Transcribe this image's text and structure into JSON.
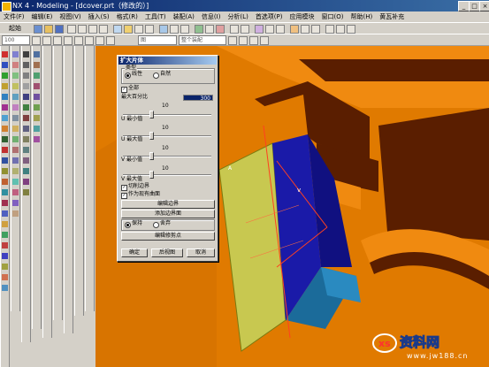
{
  "window": {
    "title": "NX 4 - Modeling - [dcover.prt（修改的）]",
    "minimize_label": "_",
    "maximize_label": "□",
    "close_label": "×"
  },
  "menubar": {
    "items": [
      "文件(F)",
      "编辑(E)",
      "视图(V)",
      "插入(S)",
      "格式(R)",
      "工具(T)",
      "装配(A)",
      "信息(I)",
      "分析(L)",
      "首选项(P)",
      "应用模块",
      "窗口(O)",
      "帮助(H)",
      "黄瓦补充"
    ]
  },
  "toolbar": {
    "start_label": "起始",
    "zoom_value": "100",
    "layer_combo": "图",
    "filter_combo": "整个装配"
  },
  "dialog": {
    "title": "扩大片体",
    "type_group_label": "类型",
    "type_options": [
      "线性",
      "自然"
    ],
    "all_label": "全部",
    "max_percent_label": "最大百分比",
    "max_percent_value": "300",
    "slider_value": "10",
    "u_min_label": "U 最小值",
    "u_max_label": "U 最大值",
    "v_min_label": "V 最小值",
    "v_max_label": "V 最大值",
    "trim_boundary_label": "切削边界",
    "as_sketch_surface_label": "作为现有曲面",
    "edit_boundary_button": "编辑边界",
    "add_boundary_button": "添加边界面",
    "keep_label": "保持",
    "discard_label": "舍弃",
    "edit_trim_points_button": "编辑修剪点",
    "ok_button": "确定",
    "back_button": "后视图",
    "cancel_button": "取消"
  },
  "viewport": {
    "label_a": "A",
    "label_v": "v"
  },
  "watermark": {
    "brand": "资料网",
    "url": "www.jw188.cn"
  },
  "colors": {
    "viewport_bg": "#e07a00",
    "surface_yellow": "#c8c850",
    "surface_blue": "#1a1aa8",
    "brown": "#5a1e00",
    "teal": "#1b6b9a"
  }
}
